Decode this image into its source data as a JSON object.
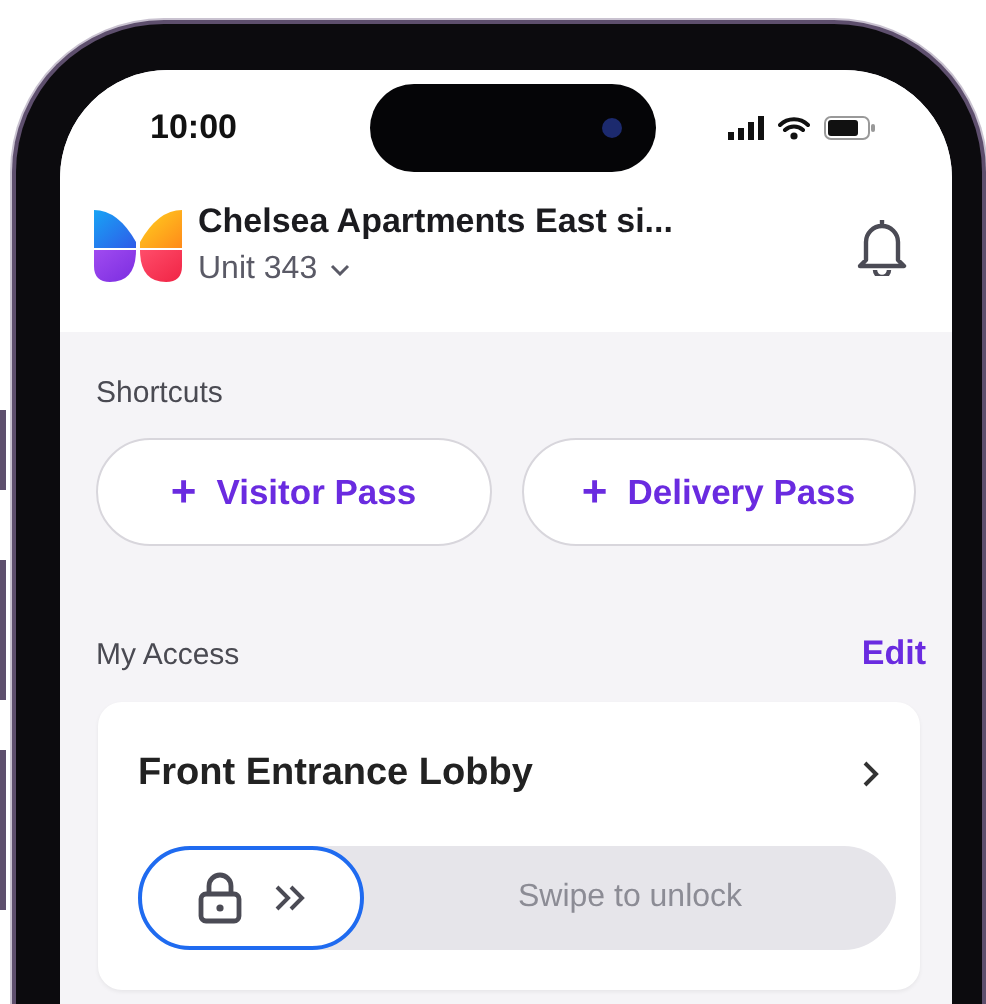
{
  "status_bar": {
    "time": "10:00"
  },
  "header": {
    "title": "Chelsea Apartments East si...",
    "unit": "Unit 343"
  },
  "shortcuts": {
    "label": "Shortcuts",
    "buttons": [
      {
        "icon": "+",
        "label": "Visitor Pass"
      },
      {
        "icon": "+",
        "label": "Delivery Pass"
      }
    ]
  },
  "my_access": {
    "label": "My Access",
    "edit": "Edit",
    "cards": [
      {
        "title": "Front Entrance Lobby",
        "slider_label": "Swipe to unlock",
        "level": 0
      }
    ]
  }
}
